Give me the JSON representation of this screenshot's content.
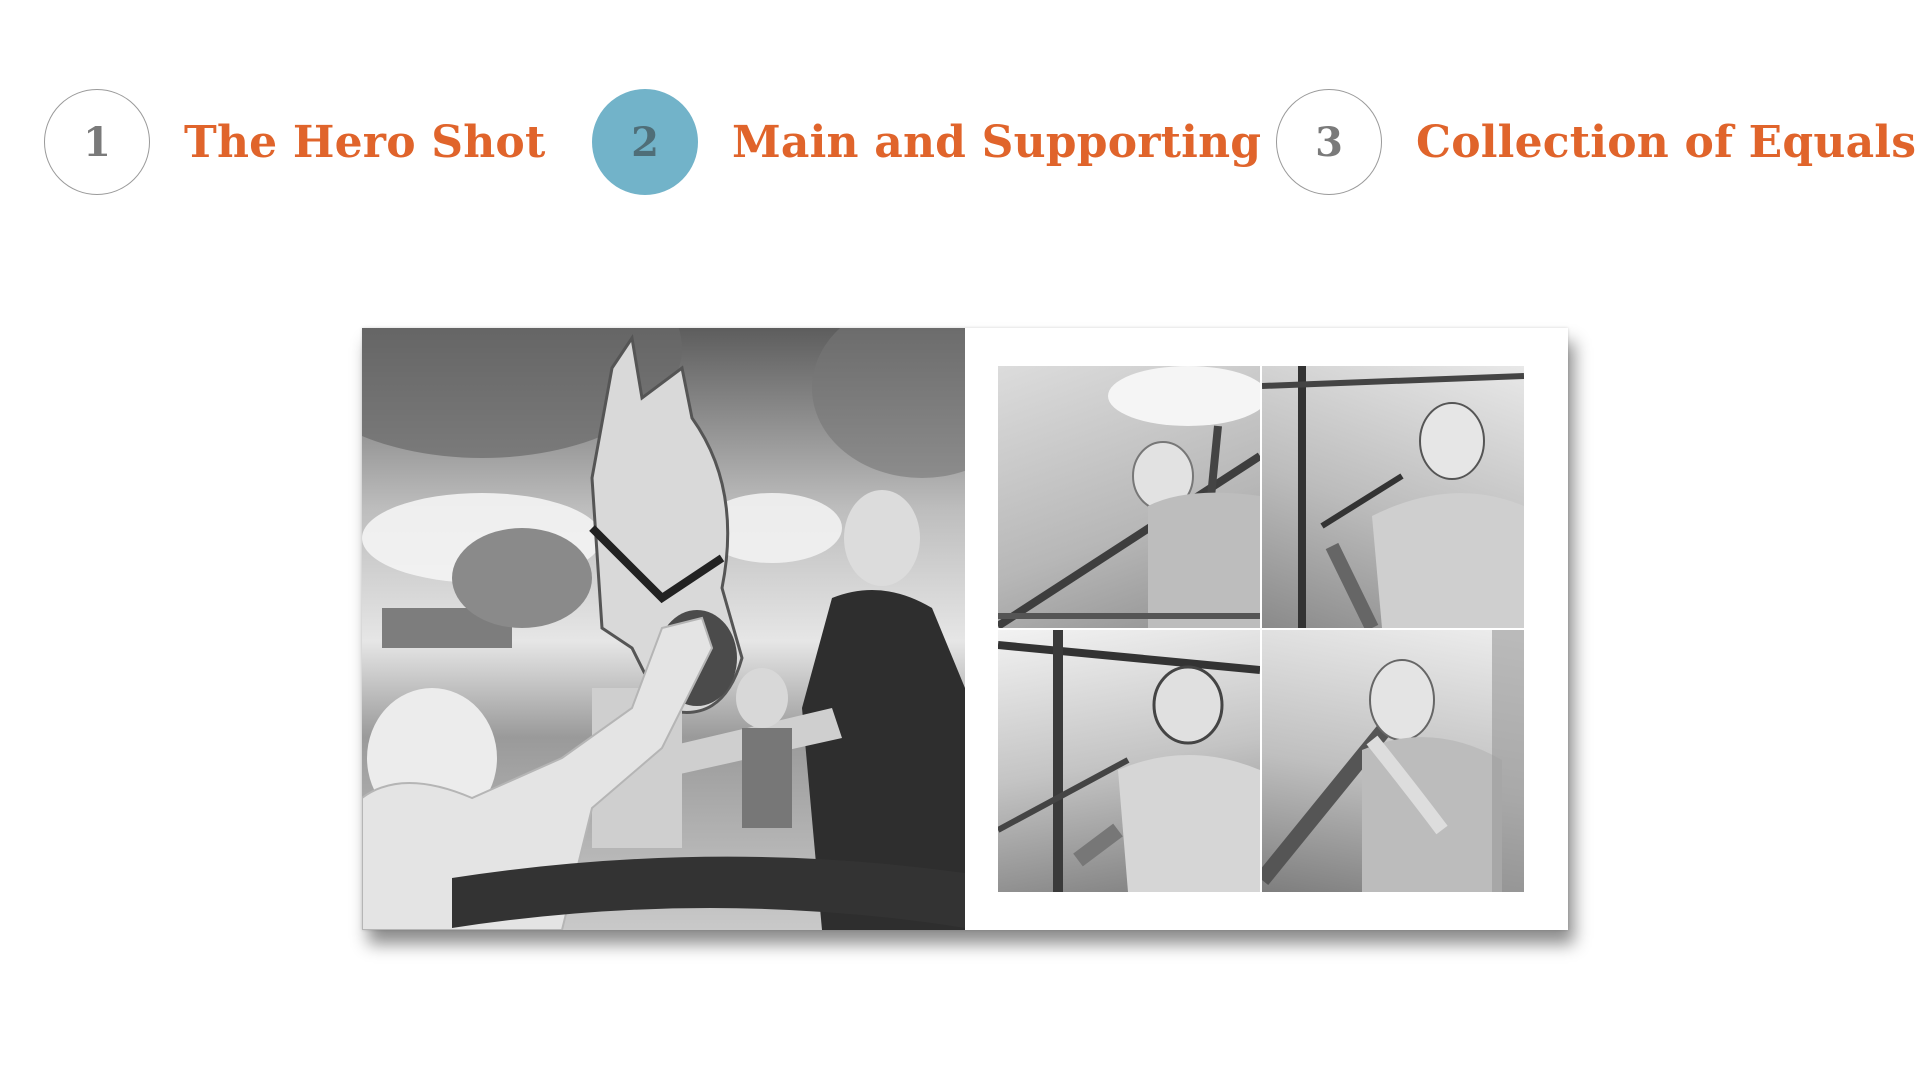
{
  "steps": [
    {
      "number": "1",
      "title": "The Hero Shot",
      "active": false
    },
    {
      "number": "2",
      "title": "Main and Supporting",
      "active": true
    },
    {
      "number": "3",
      "title": "Collection of Equals",
      "active": false
    }
  ],
  "colors": {
    "title": "#e0642b",
    "active_circle": "#72b3c9",
    "inactive_circle_border": "#9a9a9a",
    "number": "#7a7a7a"
  },
  "album_spread": {
    "main_photo": {
      "description_icon": "photo-horse-and-girl"
    },
    "supporting_photos": [
      {
        "icon": "photo-girl-on-fence"
      },
      {
        "icon": "photo-girl-smiling"
      },
      {
        "icon": "photo-girl-looking-down"
      },
      {
        "icon": "photo-girl-leaning"
      }
    ]
  }
}
